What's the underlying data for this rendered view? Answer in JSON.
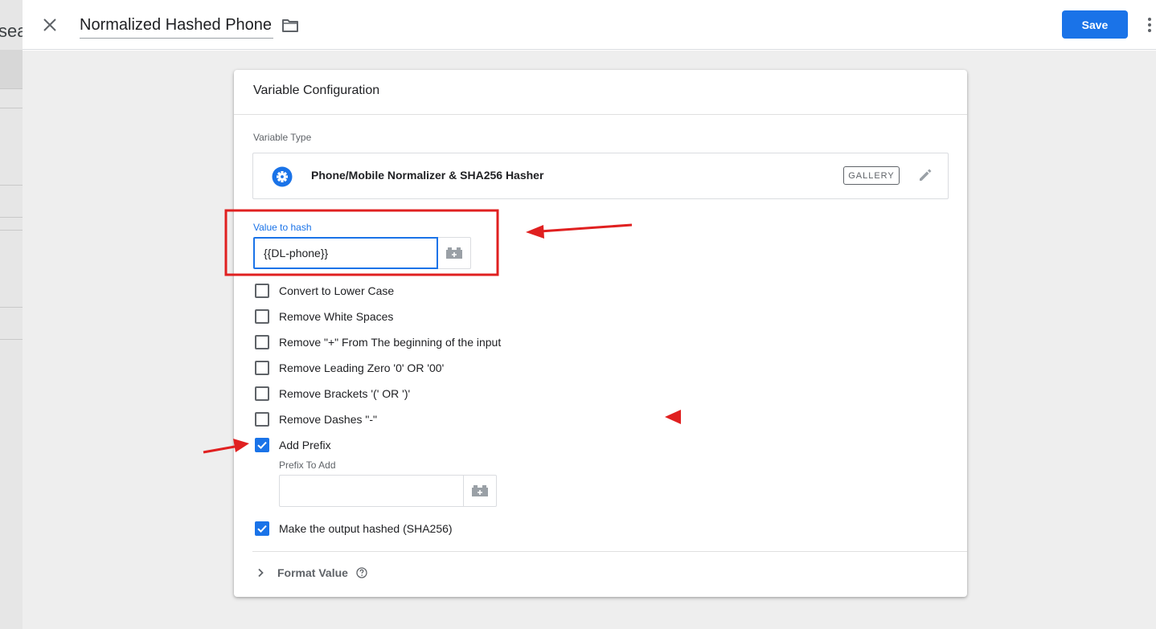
{
  "background": {
    "partial_text": "sea"
  },
  "header": {
    "title": "Normalized Hashed Phone",
    "save_label": "Save"
  },
  "card": {
    "title": "Variable Configuration",
    "variable_type_label": "Variable Type",
    "variable_type_name": "Phone/Mobile Normalizer & SHA256 Hasher",
    "gallery_label": "GALLERY",
    "value_to_hash": {
      "label": "Value to hash",
      "value": "{{DL-phone}}"
    },
    "options": [
      {
        "label": "Convert to Lower Case",
        "checked": false
      },
      {
        "label": "Remove White Spaces",
        "checked": false
      },
      {
        "label": "Remove \"+\" From The beginning of the input",
        "checked": false
      },
      {
        "label": "Remove Leading Zero '0' OR '00'",
        "checked": false
      },
      {
        "label": "Remove Brackets '(' OR ')'",
        "checked": false
      },
      {
        "label": "Remove Dashes \"-\"",
        "checked": false
      },
      {
        "label": "Add Prefix",
        "checked": true
      }
    ],
    "prefix": {
      "label": "Prefix To Add",
      "value": ""
    },
    "hash_output": {
      "label": "Make the output hashed (SHA256)",
      "checked": true
    },
    "format_value_label": "Format Value"
  },
  "colors": {
    "accent": "#1a73e8",
    "annotation": "#e02020"
  },
  "icons": {
    "close": "close-icon",
    "folder": "folder-icon",
    "more": "more-vert-icon",
    "variable_type": "gear-icon",
    "edit": "pencil-icon",
    "variable_picker": "lego-brick-icon",
    "checkbox_checked": "check-icon",
    "expand": "chevron-right-icon",
    "help": "help-icon"
  }
}
